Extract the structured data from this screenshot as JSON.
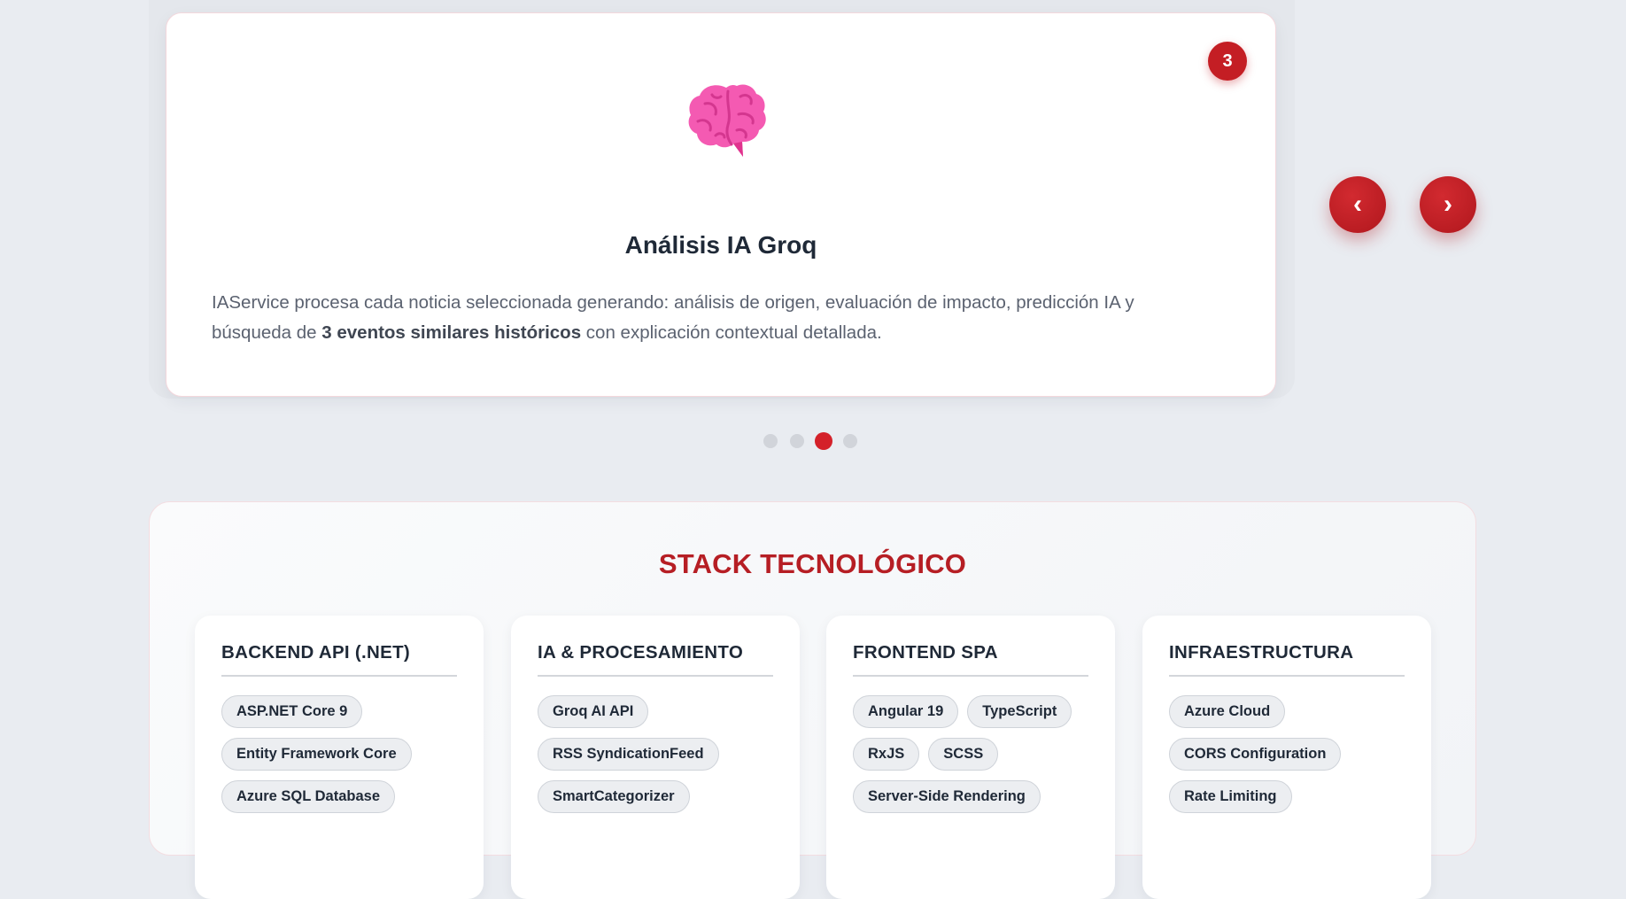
{
  "carousel": {
    "slide": {
      "number": "3",
      "title": "Análisis IA Groq",
      "desc_part1": "IAService procesa cada noticia seleccionada generando: análisis de origen, evaluación de impacto, predicción IA y búsqueda de ",
      "desc_bold": "3 eventos similares históricos",
      "desc_part2": " con explicación contextual detallada.",
      "icon": "brain-icon"
    },
    "prev_label": "‹",
    "next_label": "›",
    "dots_count": 4,
    "active_dot": 3
  },
  "stack": {
    "title": "STACK TECNOLÓGICO",
    "columns": [
      {
        "title": "BACKEND API (.NET)",
        "tags": [
          "ASP.NET Core 9",
          "Entity Framework Core",
          "Azure SQL Database"
        ]
      },
      {
        "title": "IA & PROCESAMIENTO",
        "tags": [
          "Groq AI API",
          "RSS SyndicationFeed",
          "SmartCategorizer"
        ]
      },
      {
        "title": "FRONTEND SPA",
        "tags": [
          "Angular 19",
          "TypeScript",
          "RxJS",
          "SCSS",
          "Server-Side Rendering"
        ]
      },
      {
        "title": "INFRAESTRUCTURA",
        "tags": [
          "Azure Cloud",
          "CORS Configuration",
          "Rate Limiting"
        ]
      }
    ]
  },
  "colors": {
    "accent": "#c41e24",
    "title_red": "#b61e24",
    "background": "#e9ecf1"
  }
}
